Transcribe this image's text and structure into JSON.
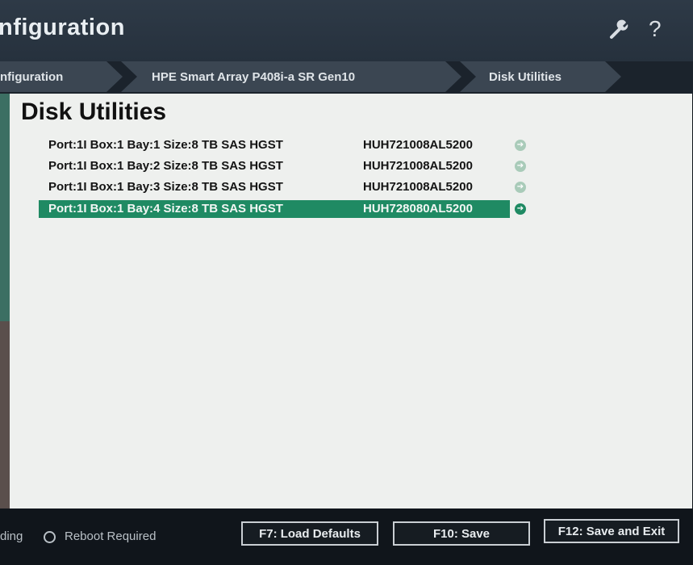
{
  "header": {
    "title": "nfiguration",
    "wrench_icon": "wrench-icon",
    "help_icon": "help-icon",
    "help_glyph": "?"
  },
  "breadcrumb": [
    {
      "label": "nfiguration"
    },
    {
      "label": "HPE Smart Array P408i-a SR Gen10"
    },
    {
      "label": "Disk Utilities"
    }
  ],
  "main": {
    "title": "Disk Utilities",
    "disks": [
      {
        "desc": "Port:1I Box:1 Bay:1 Size:8 TB SAS HGST",
        "model": "HUH721008AL5200",
        "selected": false
      },
      {
        "desc": "Port:1I Box:1 Bay:2 Size:8 TB SAS HGST",
        "model": "HUH721008AL5200",
        "selected": false
      },
      {
        "desc": "Port:1I Box:1 Bay:3 Size:8 TB SAS HGST",
        "model": "HUH721008AL5200",
        "selected": false
      },
      {
        "desc": "Port:1I Box:1 Bay:4 Size:8 TB SAS HGST",
        "model": "HUH728080AL5200",
        "selected": true
      }
    ],
    "arrow_glyph": "➔"
  },
  "footer": {
    "pending_text": "ding",
    "reboot_label": "Reboot Required",
    "buttons": {
      "f7": "F7: Load Defaults",
      "f10": "F10: Save",
      "f12": "F12: Save and Exit"
    }
  },
  "colors": {
    "accent": "#1f8a63",
    "header_bg": "#2e3a47",
    "content_bg": "#eef0ee"
  }
}
